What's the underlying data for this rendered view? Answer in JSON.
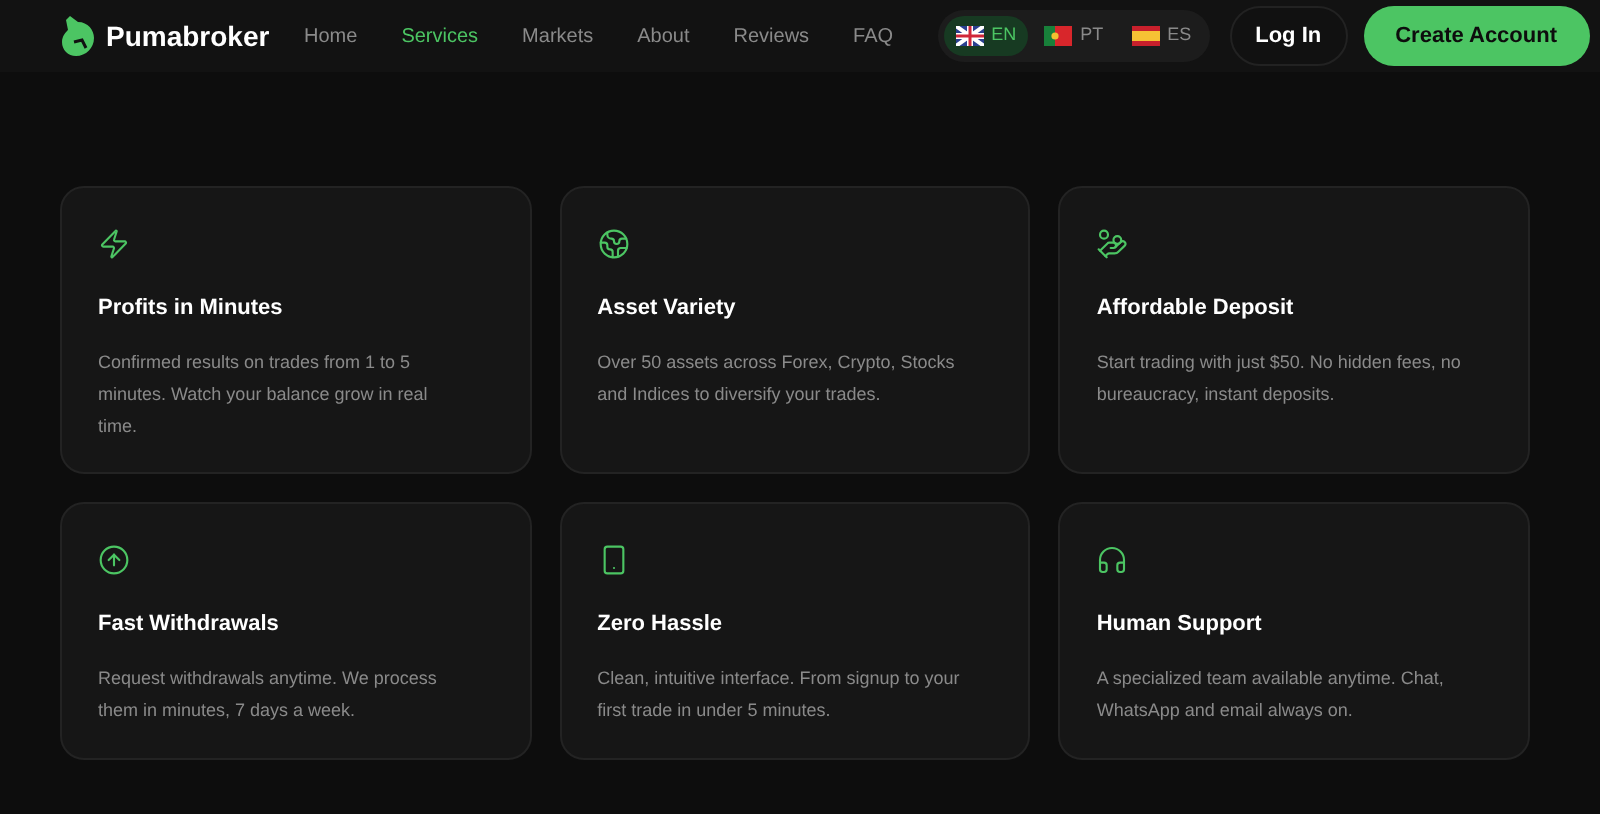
{
  "brand": {
    "name": "Pumabroker"
  },
  "nav": [
    {
      "label": "Home",
      "selected": false
    },
    {
      "label": "Services",
      "selected": true
    },
    {
      "label": "Markets",
      "selected": false
    },
    {
      "label": "About",
      "selected": false
    },
    {
      "label": "Reviews",
      "selected": false
    },
    {
      "label": "FAQ",
      "selected": false
    }
  ],
  "languages": [
    {
      "kind": "uk",
      "label": "EN",
      "selected": true
    },
    {
      "kind": "pt",
      "label": "PT",
      "selected": false
    },
    {
      "kind": "es",
      "label": "ES",
      "selected": false
    }
  ],
  "login": "Log In",
  "cta": "Create Account",
  "features": [
    {
      "kind": "bolt",
      "title": "Profits in Minutes",
      "text": "Confirmed results on trades from 1 to 5 minutes. Watch your balance grow in real time."
    },
    {
      "kind": "globe",
      "title": "Asset Variety",
      "text": "Over 50 assets across Forex, Crypto, Stocks and Indices to diversify your trades."
    },
    {
      "kind": "hand-coins",
      "title": "Affordable Deposit",
      "text": "Start trading with just $50. No hidden fees, no bureaucracy, instant deposits."
    },
    {
      "kind": "arrow-up",
      "title": "Fast Withdrawals",
      "text": "Request withdrawals anytime. We process them in minutes, 7 days a week."
    },
    {
      "kind": "phone",
      "title": "Zero Hassle",
      "text": "Clean, intuitive interface. From signup to your first trade in under 5 minutes."
    },
    {
      "kind": "headphones",
      "title": "Human Support",
      "text": "A specialized team available anytime. Chat, WhatsApp and email always on."
    }
  ]
}
